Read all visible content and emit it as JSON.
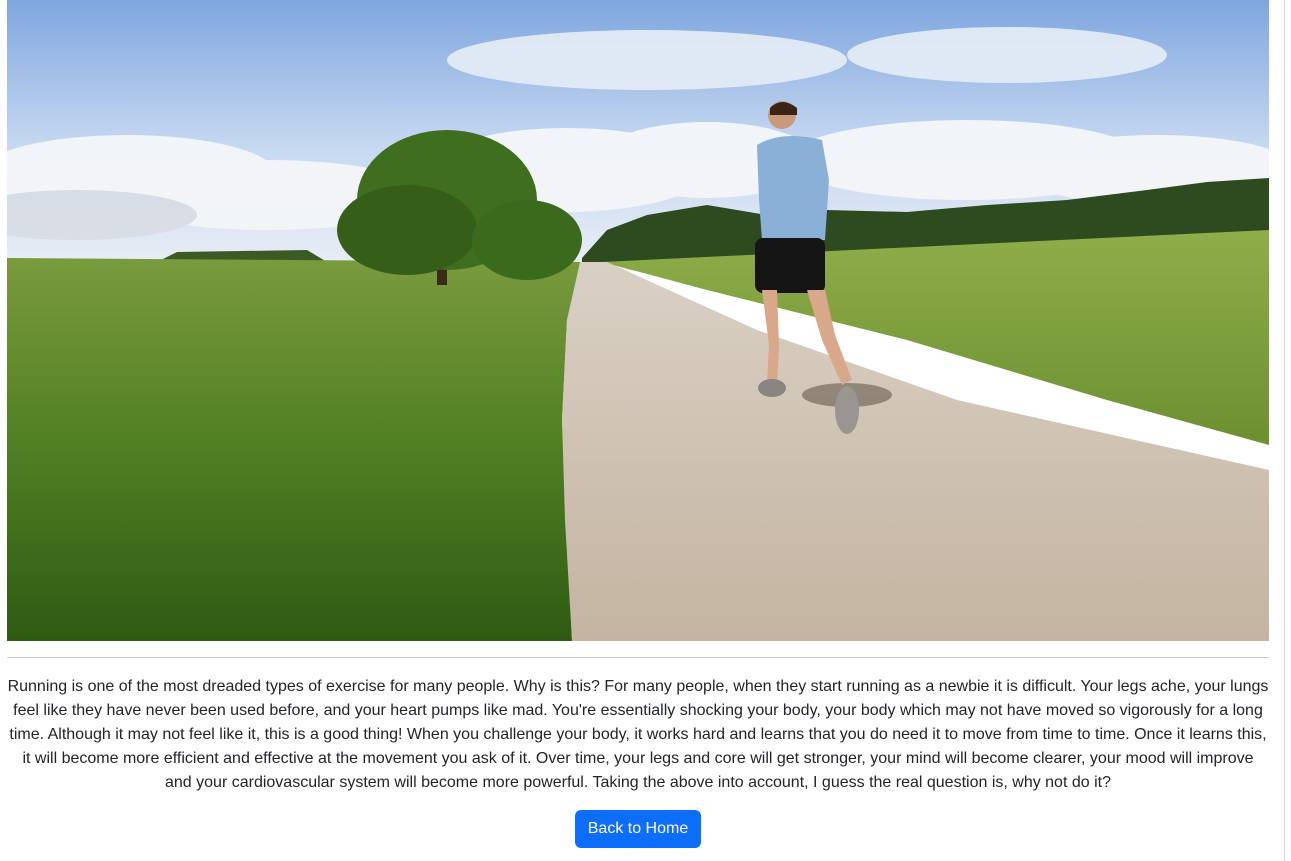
{
  "hero": {
    "image_icon": "runner-on-country-road-photo",
    "sky_color": "#8fb4e6",
    "grass_color": "#5f8f2a",
    "road_color": "#cdbfae"
  },
  "article": {
    "body": "Running is one of the most dreaded types of exercise for many people. Why is this? For many people, when they start running as a newbie it is difficult. Your legs ache, your lungs feel like they have never been used before, and your heart pumps like mad. You're essentially shocking your body, your body which may not have moved so vigorously for a long time. Although it may not feel like it, this is a good thing! When you challenge your body, it works hard and learns that you do need it to move from time to time. Once it learns this, it will become more efficient and effective at the movement you ask of it. Over time, your legs and core will get stronger, your mind will become clearer, your mood will improve and your cardiovascular system will become more powerful. Taking the above into account, I guess the real question is, why not do it?"
  },
  "actions": {
    "back_label": "Back to Home",
    "accent": "#0d6efd"
  }
}
